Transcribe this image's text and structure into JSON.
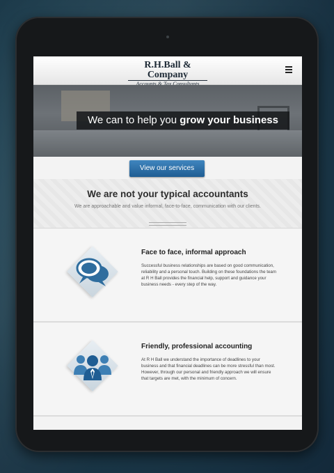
{
  "header": {
    "logo_name": "R.H.Ball & Company",
    "logo_sub": "Accounts & Tax Consultants",
    "menu_icon": "hamburger-icon"
  },
  "hero": {
    "caption_prefix": "We can to help you",
    "caption_bold": "grow your business",
    "cta_label": "View our services"
  },
  "intro": {
    "heading": "We are not your typical accountants",
    "text": "We are approachable and value informal, face-to-face, communication with our clients."
  },
  "features": [
    {
      "icon": "speech-bubbles-icon",
      "title": "Face to face, informal approach",
      "body": "Successful business relationships are based on good communication, reliability and a personal touch. Building on these foundations the team at R H Ball provides the financial help, support and guidance your business needs - every step of the way."
    },
    {
      "icon": "team-icon",
      "title": "Friendly, professional accounting",
      "body": "At R H Ball we understand the importance of deadlines to your business and that financial deadlines can be more stressful than most. However, through our personal and friendly approach we will ensure that targets are met, with the minimum of concern."
    }
  ],
  "colors": {
    "accent": "#2a6aa3",
    "icon_blue": "#2f6d9e",
    "dark_text": "#222222"
  }
}
